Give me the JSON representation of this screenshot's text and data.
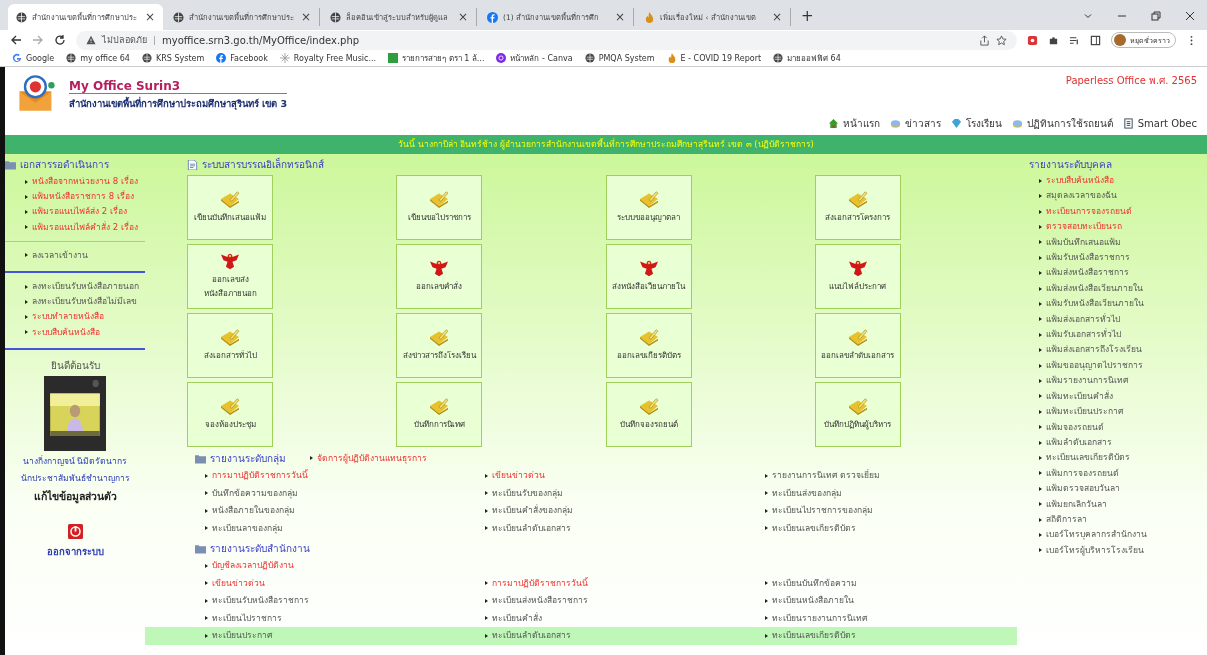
{
  "browser": {
    "tabs": [
      {
        "title": "สำนักงานเขตพื้นที่การศึกษาประ",
        "kind": "globe",
        "close": "×",
        "selected": true
      },
      {
        "title": "สำนักงานเขตพื้นที่การศึกษาประ",
        "kind": "globe",
        "close": "×",
        "selected": false
      },
      {
        "title": "ล็อคอินเข้าสู่ระบบสำหรับผู้ดูแล",
        "kind": "globe",
        "close": "×",
        "selected": false
      },
      {
        "title": "(1) สำนักงานเขตพื้นที่การศึก",
        "kind": "facebook",
        "close": "×",
        "selected": false
      },
      {
        "title": "เพิ่มเรื่องใหม่ ‹ สำนักงานเขต",
        "kind": "flame",
        "close": "×",
        "selected": false
      }
    ],
    "new_tab": "+",
    "security": "ไม่ปลอดภัย",
    "separator": "|",
    "url": "myoffice.srn3.go.th/MyOffice/index.php",
    "profile": "หยุดชั่วคราว",
    "bookmarks": [
      {
        "label": "Google",
        "kind": "google"
      },
      {
        "label": "my office 64",
        "kind": "globe"
      },
      {
        "label": "KRS System",
        "kind": "globe"
      },
      {
        "label": "Facebook",
        "kind": "facebook"
      },
      {
        "label": "Royalty Free Music...",
        "kind": "sparkle"
      },
      {
        "label": "รายการสายๆ ตรา 1 ล้...",
        "kind": "square"
      },
      {
        "label": "หน้าหลัก - Canva",
        "kind": "canva"
      },
      {
        "label": "PMQA System",
        "kind": "globe"
      },
      {
        "label": "E - COVID 19 Report",
        "kind": "flame"
      },
      {
        "label": "มายออฟฟิศ 64",
        "kind": "globe"
      }
    ]
  },
  "header": {
    "title": "My Office Surin3",
    "subtitle": "สำนักงานเขตพื้นที่การศึกษาประถมศึกษาสุรินทร์ เขต 3",
    "tagline": "Paperless Office พ.ศ. 2565",
    "nav": [
      {
        "label": "หน้าแรก",
        "kind": "home"
      },
      {
        "label": "ข่าวสาร",
        "kind": "disc"
      },
      {
        "label": "โรงเรียน",
        "kind": "gem"
      },
      {
        "label": "ปฏิทินการใช้รถยนต์",
        "kind": "disc"
      },
      {
        "label": "Smart Obec",
        "kind": "doc"
      }
    ],
    "announcement": "วันนี้ นางกาบิล่า อินทร์ช้าง ผู้อำนวยการสำนักงานเขตพื้นที่การศึกษาประถมศึกษาสุรินทร์ เขต ๓ (ปฏิบัติราชการ)"
  },
  "left": {
    "heading": "เอกสารรอดำเนินการ",
    "groups": [
      [
        {
          "label": "หนังสือจากหน่วยงาน 8 เรื่อง",
          "highlighted": true
        },
        {
          "label": "แฟ้มหนังสือราชการ 8 เรื่อง",
          "highlighted": true
        },
        {
          "label": "แฟ้มรอแนบไฟล์ส่ง 2 เรื่อง",
          "highlighted": true
        },
        {
          "label": "แฟ้มรอแนบไฟล์คำสั่ง 2 เรื่อง",
          "highlighted": true
        }
      ],
      [
        {
          "label": "ลงเวลาเข้างาน",
          "highlighted": false
        }
      ],
      [
        {
          "label": "ลงทะเบียนรับหนังสือภายนอก",
          "highlighted": false
        },
        {
          "label": "ลงทะเบียนรับหนังสือไม่มีเลข",
          "highlighted": false
        },
        {
          "label": "ระบบทำลายหนังสือ",
          "highlighted": true
        },
        {
          "label": "ระบบสืบค้นหนังสือ",
          "highlighted": true
        }
      ]
    ],
    "welcome": "ยินดีต้อนรับ",
    "user_name": "นางกิ่งกาญจน์ นิมิตรัตนากร",
    "user_position": "นักประชาสัมพันธ์ชำนาญการ",
    "edit_profile": "แก้ไขข้อมูลส่วนตัว",
    "logout": "ออกจากระบบ"
  },
  "center": {
    "heading": "ระบบสารบรรณอิเล็กทรอนิกส์",
    "tiles": [
      {
        "label": "เขียนบันทึกเสนอแฟ้ม",
        "kind": "note"
      },
      {
        "label": "เขียนขอไปราชการ",
        "kind": "note"
      },
      {
        "label": "ระบบขออนุญาตลา",
        "kind": "note"
      },
      {
        "label": "ส่งเอกสารโครงการ",
        "kind": "note"
      },
      {
        "label": "ออกเลขส่ง\nหนังสือภายนอก",
        "kind": "emblem"
      },
      {
        "label": "ออกเลขคำสั่ง",
        "kind": "emblem"
      },
      {
        "label": "ส่งหนังสือเวียนภายใน",
        "kind": "emblem"
      },
      {
        "label": "แนบไฟล์ประกาศ",
        "kind": "emblem"
      },
      {
        "label": "ส่งเอกสารทั่วไป",
        "kind": "note"
      },
      {
        "label": "ส่งข่าวสารถึงโรงเรียน",
        "kind": "note"
      },
      {
        "label": "ออกเลขเกียรติบัตร",
        "kind": "note"
      },
      {
        "label": "ออกเลขลำดับเอกสาร",
        "kind": "note"
      },
      {
        "label": "จองห้องประชุม",
        "kind": "note"
      },
      {
        "label": "บันทึกการนิเทศ",
        "kind": "note"
      },
      {
        "label": "บันทึกจองรถยนต์",
        "kind": "note"
      },
      {
        "label": "บันทึกปฏิทินผู้บริหาร",
        "kind": "note"
      }
    ],
    "group_report": {
      "heading": "รายงานระดับกลุ่ม",
      "manage_link": "จัดการผู้ปฏิบัติงานแทนธุรการ",
      "rows": [
        {
          "highlighted": false,
          "links": [
            {
              "label": "การมาปฏิบัติราชการวันนี้",
              "highlighted": true
            },
            {
              "label": "เขียนข่าวด่วน",
              "highlighted": true
            },
            {
              "label": "รายงานการนิเทศ ตรวจเยี่ยม",
              "highlighted": false
            }
          ]
        },
        {
          "highlighted": false,
          "links": [
            {
              "label": "บันทึกข้อความของกลุ่ม",
              "highlighted": false
            },
            {
              "label": "ทะเบียนรับของกลุ่ม",
              "highlighted": false
            },
            {
              "label": "ทะเบียนส่งของกลุ่ม",
              "highlighted": false
            }
          ]
        },
        {
          "highlighted": false,
          "links": [
            {
              "label": "หนังสือภายในของกลุ่ม",
              "highlighted": false
            },
            {
              "label": "ทะเบียนคำสั่งของกลุ่ม",
              "highlighted": false
            },
            {
              "label": "ทะเบียนไปราชการของกลุ่ม",
              "highlighted": false
            }
          ]
        },
        {
          "highlighted": false,
          "links": [
            {
              "label": "ทะเบียนลาของกลุ่ม",
              "highlighted": false
            },
            {
              "label": "ทะเบียนลำดับเอกสาร",
              "highlighted": false
            },
            {
              "label": "ทะเบียนเลขเกียรติบัตร",
              "highlighted": false
            }
          ]
        }
      ]
    },
    "office_report": {
      "heading": "รายงานระดับสำนักงาน",
      "first_link": "บัญชีลงเวลาปฏิบัติงาน",
      "rows": [
        {
          "highlighted": false,
          "links": [
            {
              "label": "เขียนข่าวด่วน",
              "highlighted": true
            },
            {
              "label": "การมาปฏิบัติราชการวันนี้",
              "highlighted": true
            },
            {
              "label": "ทะเบียนบันทึกข้อความ",
              "highlighted": false
            }
          ]
        },
        {
          "highlighted": false,
          "links": [
            {
              "label": "ทะเบียนรับหนังสือราชการ",
              "highlighted": false
            },
            {
              "label": "ทะเบียนส่งหนังสือราชการ",
              "highlighted": false
            },
            {
              "label": "ทะเบียนหนังสือภายใน",
              "highlighted": false
            }
          ]
        },
        {
          "highlighted": false,
          "links": [
            {
              "label": "ทะเบียนไปราชการ",
              "highlighted": false
            },
            {
              "label": "ทะเบียนคำสั่ง",
              "highlighted": false
            },
            {
              "label": "ทะเบียนรายงานการนิเทศ",
              "highlighted": false
            }
          ]
        },
        {
          "highlighted": true,
          "links": [
            {
              "label": "ทะเบียนประกาศ",
              "highlighted": false
            },
            {
              "label": "ทะเบียนลำดับเอกสาร",
              "highlighted": false
            },
            {
              "label": "ทะเบียนเลขเกียรติบัตร",
              "highlighted": false
            }
          ]
        }
      ]
    }
  },
  "right": {
    "heading": "รายงานระดับบุคคล",
    "items": [
      {
        "label": "ระบบสืบค้นหนังสือ",
        "highlighted": true
      },
      {
        "label": "สมุดลงเวลาของฉัน",
        "highlighted": false
      },
      {
        "label": "ทะเบียนการจองรถยนต์",
        "highlighted": true
      },
      {
        "label": "ตรวจสอบทะเบียนรถ",
        "highlighted": true
      },
      {
        "label": "แฟ้มบันทึกเสนอแฟ้ม",
        "highlighted": false
      },
      {
        "label": "แฟ้มรับหนังสือราชการ",
        "highlighted": false
      },
      {
        "label": "แฟ้มส่งหนังสือราชการ",
        "highlighted": false
      },
      {
        "label": "แฟ้มส่งหนังสือเวียนภายใน",
        "highlighted": false
      },
      {
        "label": "แฟ้มรับหนังสือเวียนภายใน",
        "highlighted": false
      },
      {
        "label": "แฟ้มส่งเอกสารทั่วไป",
        "highlighted": false
      },
      {
        "label": "แฟ้มรับเอกสารทั่วไป",
        "highlighted": false
      },
      {
        "label": "แฟ้มส่งเอกสารถึงโรงเรียน",
        "highlighted": false
      },
      {
        "label": "แฟ้มขออนุญาตไปราชการ",
        "highlighted": false
      },
      {
        "label": "แฟ้มรายงานการนิเทศ",
        "highlighted": false
      },
      {
        "label": "แฟ้มทะเบียนคำสั่ง",
        "highlighted": false
      },
      {
        "label": "แฟ้มทะเบียนประกาศ",
        "highlighted": false
      },
      {
        "label": "แฟ้มจองรถยนต์",
        "highlighted": false
      },
      {
        "label": "แฟ้มลำดับเอกสาร",
        "highlighted": false
      },
      {
        "label": "ทะเบียนเลขเกียรติบัตร",
        "highlighted": false
      },
      {
        "label": "แฟ้มการจองรถยนต์",
        "highlighted": false
      },
      {
        "label": "แฟ้มตรวจสอบวันลา",
        "highlighted": false
      },
      {
        "label": "แฟ้มยกเลิกวันลา",
        "highlighted": false
      },
      {
        "label": "สถิติการลา",
        "highlighted": false
      },
      {
        "label": "เบอร์โทรบุคลากรสำนักงาน",
        "highlighted": false
      },
      {
        "label": "เบอร์โทรผู้บริหารโรงเรียน",
        "highlighted": false
      }
    ]
  }
}
